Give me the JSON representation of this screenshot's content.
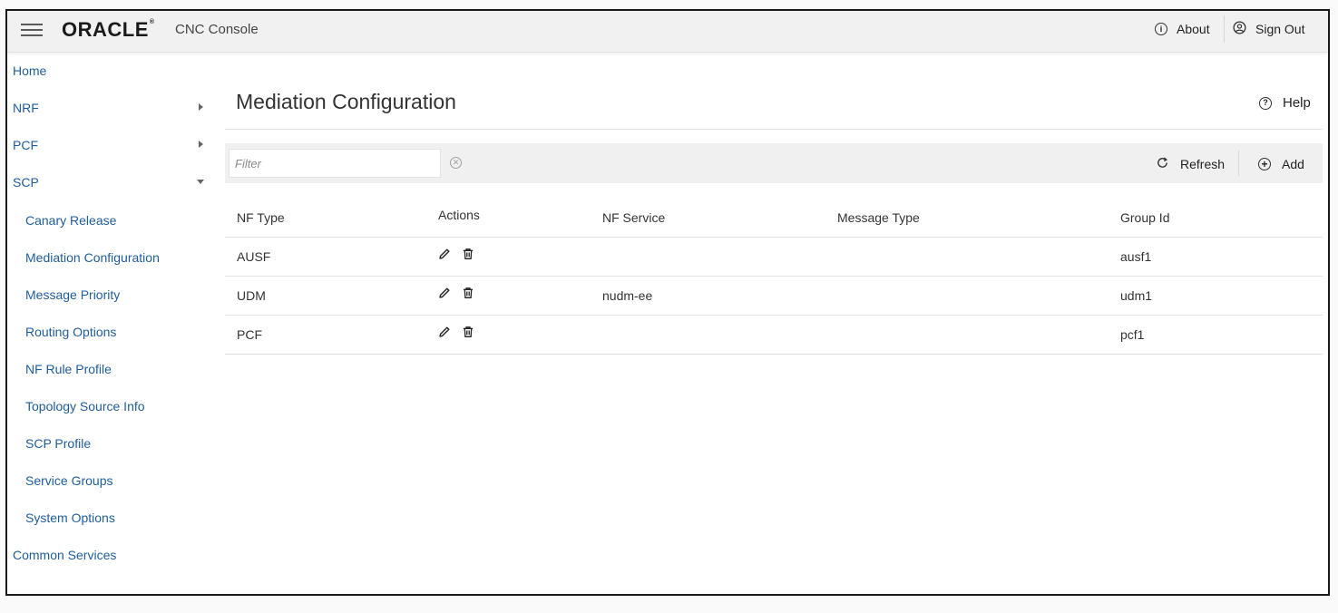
{
  "header": {
    "logo": "ORACLE",
    "logo_mark": "®",
    "app_name": "CNC Console",
    "about_label": "About",
    "about_icon": "info-icon",
    "signout_label": "Sign Out",
    "signout_icon": "user-circle-icon"
  },
  "sidebar": {
    "items": [
      {
        "label": "Home",
        "level": 0
      },
      {
        "label": "NRF",
        "level": 0,
        "caret": "collapsed"
      },
      {
        "label": "PCF",
        "level": 0,
        "caret": "collapsed"
      },
      {
        "label": "SCP",
        "level": 0,
        "caret": "expanded"
      },
      {
        "label": "Canary Release",
        "level": 1
      },
      {
        "label": "Mediation Configuration",
        "level": 1
      },
      {
        "label": "Message Priority",
        "level": 1
      },
      {
        "label": "Routing Options",
        "level": 1
      },
      {
        "label": "NF Rule Profile",
        "level": 1
      },
      {
        "label": "Topology Source Info",
        "level": 1
      },
      {
        "label": "SCP Profile",
        "level": 1
      },
      {
        "label": "Service Groups",
        "level": 1
      },
      {
        "label": "System Options",
        "level": 1
      },
      {
        "label": "Common Services",
        "level": 0
      }
    ]
  },
  "main": {
    "title": "Mediation Configuration",
    "help_label": "Help",
    "help_icon": "question-circle-icon",
    "filter": {
      "placeholder": "Filter",
      "value": ""
    },
    "refresh_label": "Refresh",
    "add_label": "Add",
    "table": {
      "columns": [
        "NF Type",
        "Actions",
        "NF Service",
        "Message Type",
        "Group Id"
      ],
      "rows": [
        {
          "nf_type": "AUSF",
          "nf_service": "",
          "message_type": "",
          "group_id": "ausf1"
        },
        {
          "nf_type": "UDM",
          "nf_service": "nudm-ee",
          "message_type": "",
          "group_id": "udm1"
        },
        {
          "nf_type": "PCF",
          "nf_service": "",
          "message_type": "",
          "group_id": "pcf1"
        }
      ]
    }
  },
  "colors": {
    "nav_link": "#1f5d9c",
    "header_bg": "#f1f1f1",
    "toolbar_bg": "#f0f0f0"
  }
}
